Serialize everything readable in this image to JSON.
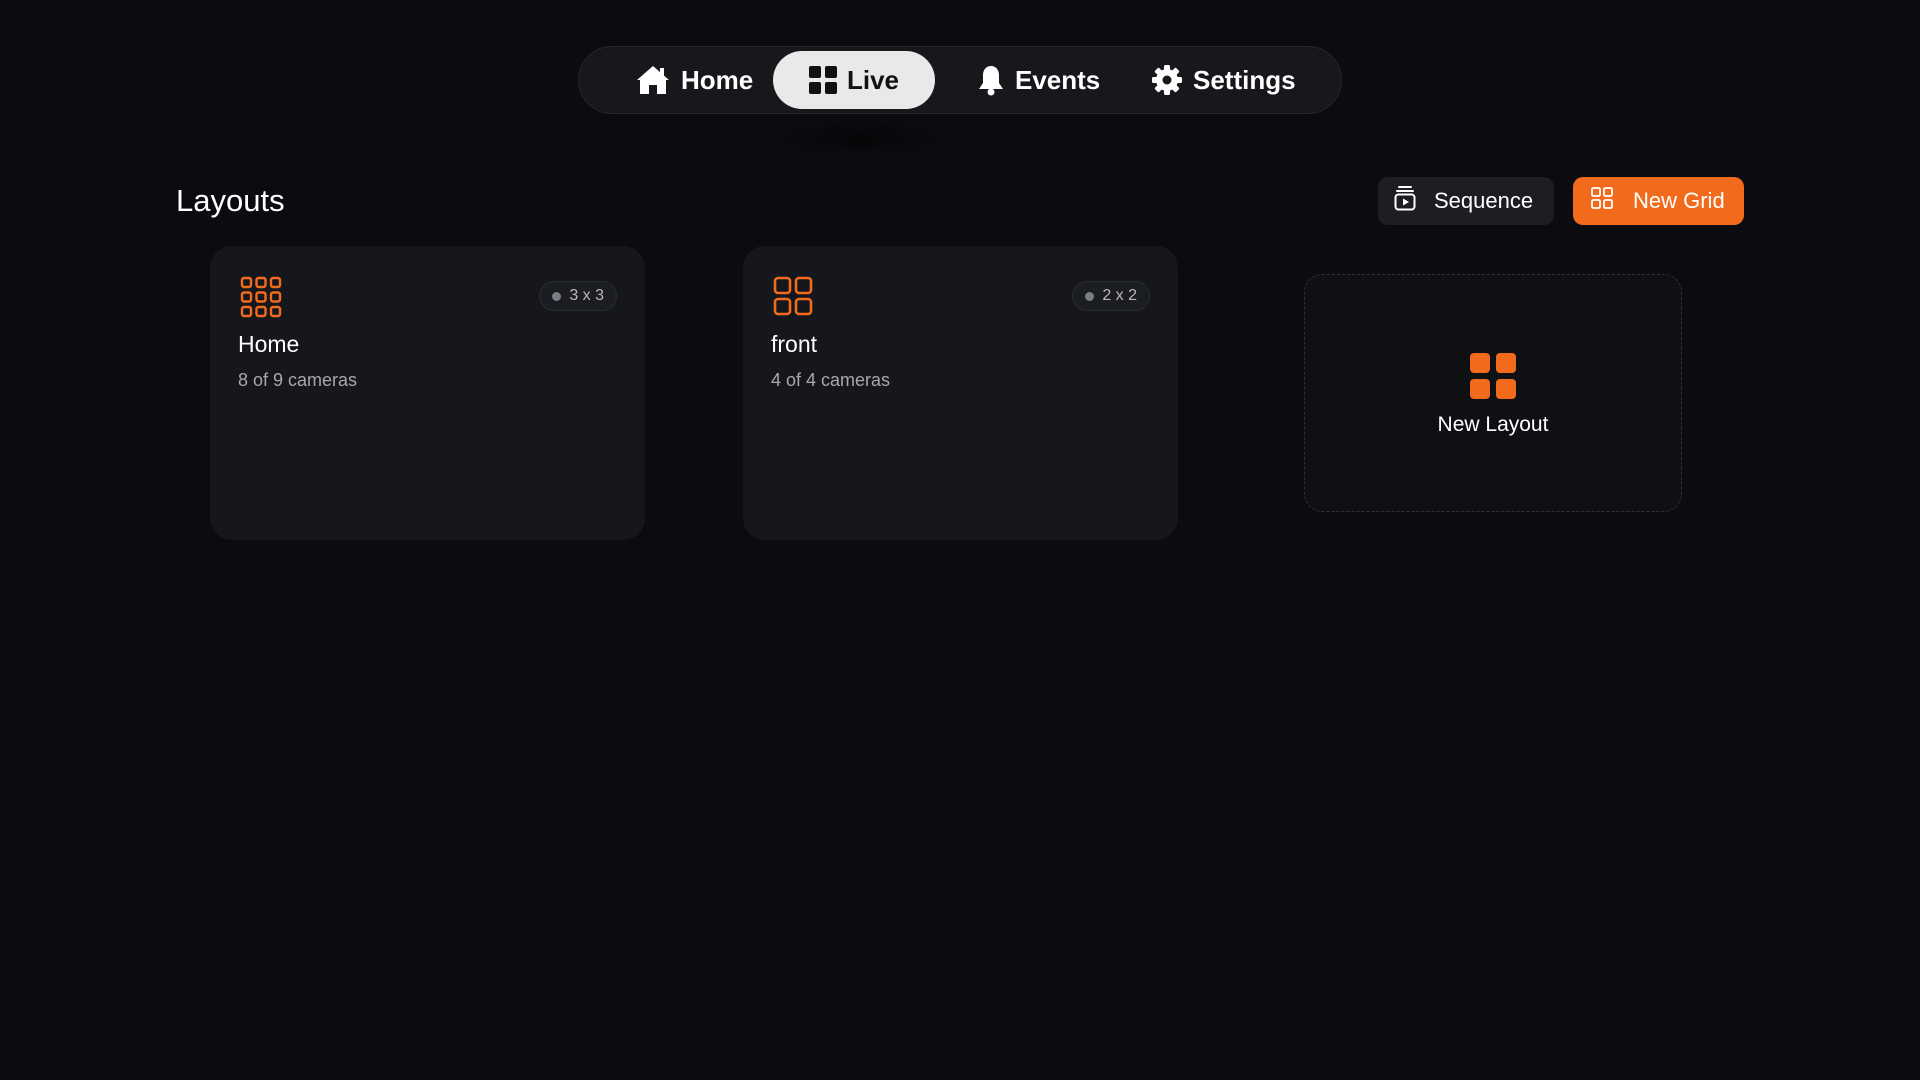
{
  "nav": {
    "items": [
      {
        "label": "Home",
        "icon": "home-icon"
      },
      {
        "label": "Live",
        "icon": "grid-icon",
        "active": true
      },
      {
        "label": "Events",
        "icon": "bell-icon"
      },
      {
        "label": "Settings",
        "icon": "gear-icon"
      }
    ]
  },
  "page": {
    "title": "Layouts"
  },
  "actions": {
    "sequence_label": "Sequence",
    "new_grid_label": "New Grid"
  },
  "layouts": [
    {
      "name": "Home",
      "grid": "3 x 3",
      "cameras": "8 of 9 cameras"
    },
    {
      "name": "front",
      "grid": "2 x 2",
      "cameras": "4 of 4 cameras"
    }
  ],
  "new_layout": {
    "label": "New Layout"
  },
  "colors": {
    "background": "#0b0c10",
    "card": "#15171c",
    "accent": "#f26b1d",
    "active_tab": "#e9e9ea"
  }
}
